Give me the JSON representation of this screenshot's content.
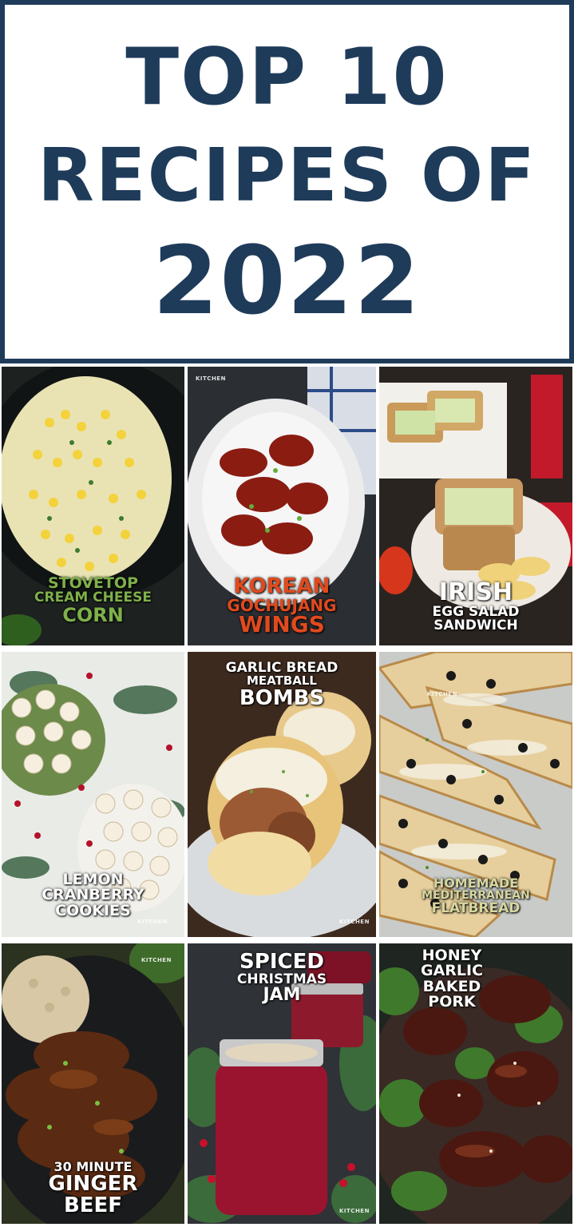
{
  "header": {
    "line1": "TOP 10",
    "line2": "RECIPES OF",
    "line3": "2022"
  },
  "watermark": "KITCHEN",
  "recipes": [
    {
      "lines": [
        "STOVETOP",
        "CREAM CHEESE",
        "CORN"
      ],
      "color": "#7fb04a"
    },
    {
      "lines": [
        "KOREAN",
        "GOCHUJANG",
        "WINGS"
      ],
      "color": "#e04a1e"
    },
    {
      "lines": [
        "IRISH",
        "EGG SALAD",
        "SANDWICH"
      ],
      "color": "#ffffff"
    },
    {
      "lines": [
        "LEMON",
        "CRANBERRY",
        "COOKIES"
      ],
      "color": "#ffffff"
    },
    {
      "lines": [
        "GARLIC BREAD",
        "MEATBALL",
        "BOMBS"
      ],
      "color": "#ffffff"
    },
    {
      "lines": [
        "HOMEMADE",
        "MEDITERRANEAN",
        "FLATBREAD"
      ],
      "color": "#d7d7a0"
    },
    {
      "lines": [
        "30 MINUTE",
        "GINGER",
        "BEEF"
      ],
      "color": "#ffffff"
    },
    {
      "lines": [
        "SPICED",
        "CHRISTMAS",
        "JAM"
      ],
      "color": "#ffffff"
    },
    {
      "lines": [
        "HONEY",
        "GARLIC",
        "BAKED",
        "PORK"
      ],
      "color": "#ffffff"
    }
  ]
}
